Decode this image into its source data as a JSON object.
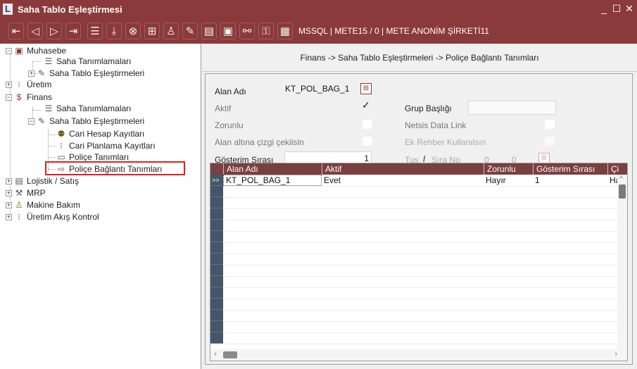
{
  "window": {
    "title": "Saha Tablo Eşleştirmesi",
    "minimize": "_",
    "maximize": "☐",
    "close": "✕"
  },
  "toolbar": {
    "connection": "MSSQL | METE15 / 0 | METE ANONİM ŞİRKETİ11"
  },
  "tree": {
    "muhasebe": "Muhasebe",
    "muh_saha_tanim": "Saha Tanımlamaları",
    "muh_saha_eslestir": "Saha Tablo Eşleştirmeleri",
    "uretim": "Üretim",
    "finans": "Finans",
    "fin_saha_tanim": "Saha Tanımlamaları",
    "fin_saha_eslestir": "Saha Tablo Eşleştirmeleri",
    "cari_hesap": "Cari Hesap Kayıtları",
    "cari_planlama": "Cari Planlama Kayıtları",
    "police_tanim": "Poliçe Tanımları",
    "police_baglanti": "Poliçe Bağlantı Tanımları",
    "lojistik": "Lojistik / Satış",
    "mrp": "MRP",
    "makine": "Makine Bakım",
    "uretim_akis": "Üretim Akış Kontrol"
  },
  "breadcrumb": "Finans -> Saha Tablo Eşleştirmeleri -> Poliçe Bağlantı Tanımları",
  "form": {
    "alan_adi_label": "Alan Adı",
    "alan_adi_value": "KT_POL_BAG_1",
    "aktif_label": "Aktif",
    "aktif_checked": true,
    "grup_basligi_label": "Grup Başlığı",
    "grup_basligi_value": "",
    "zorunlu_label": "Zorunlu",
    "netsis_label": "Netsis Data Link",
    "alan_alti_label": "Alan altına çizgi çekilsin",
    "ek_rehber_label": "Ek Rehber Kullanılsın",
    "gosterim_label": "Gösterim Sırası",
    "gosterim_value": "1",
    "tus_label": "Tuş",
    "slash": "/",
    "sira_label": "Sıra No",
    "tus_value": "0",
    "sira_value": "0"
  },
  "grid": {
    "columns": [
      "Alan Adı",
      "Aktif",
      "Zorunlu",
      "Gösterim Sırası",
      "Çi"
    ],
    "row_indicator": ">>",
    "rows": [
      {
        "alan_adi": "KT_POL_BAG_1",
        "aktif": "Evet",
        "zorunlu": "Hayır",
        "gosterim": "1",
        "extra": "Hay"
      }
    ]
  },
  "colors": {
    "accent": "#8a3a3a",
    "grid_header": "#7a3f3f",
    "row_indicator": "#45566a",
    "highlight": "#e02020"
  }
}
